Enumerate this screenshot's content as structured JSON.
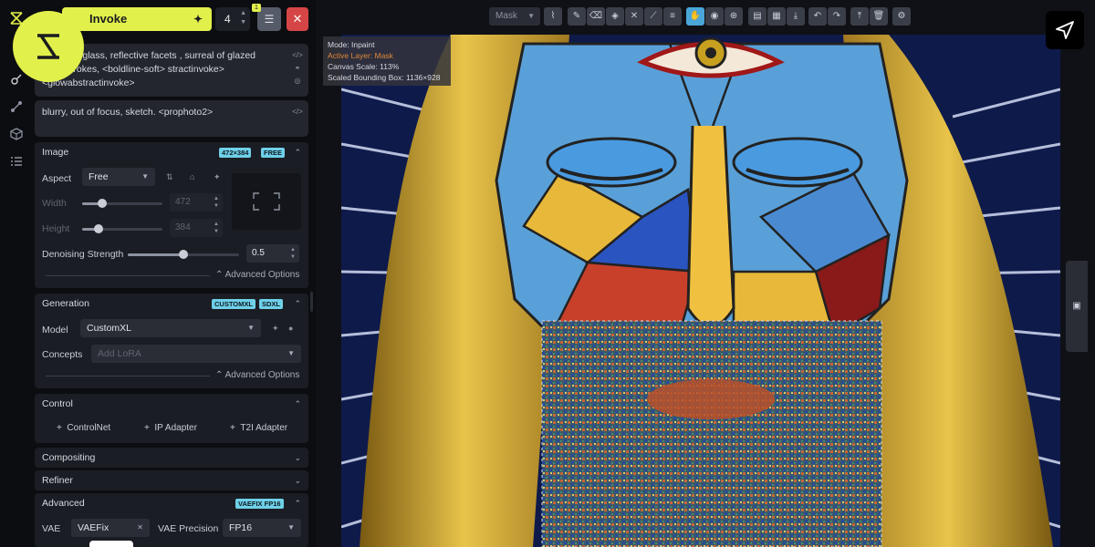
{
  "rail": {
    "icons": [
      "invoke-logo-icon",
      "brush-icon",
      "workflow-icon",
      "models-icon",
      "queue-list-icon"
    ]
  },
  "logo_badge": {
    "icon": "invoke-logo-icon",
    "color": "#e2f04b"
  },
  "topbar": {
    "invoke_label": "Invoke",
    "iterations": "4",
    "queue_count": "1"
  },
  "positive_prompt": {
    "text": "fractured glass, reflective facets , surreal of glazed brushstrokes, <boldline-soft> stractinvoke> <glowabstractinvoke>"
  },
  "negative_prompt": {
    "text": "blurry, out of focus, sketch. <prophoto2>"
  },
  "image": {
    "title": "Image",
    "size_badge": "472×384",
    "free_badge": "FREE",
    "aspect_label": "Aspect",
    "aspect_value": "Free",
    "width_label": "Width",
    "width_value": "472",
    "width_fraction": 0.25,
    "height_label": "Height",
    "height_value": "384",
    "height_fraction": 0.2,
    "denoise_label": "Denoising Strength",
    "denoise_value": "0.5",
    "advanced_label": "Advanced Options"
  },
  "generation": {
    "title": "Generation",
    "badge1": "CUSTOMXL",
    "badge2": "SDXL",
    "model_label": "Model",
    "model_value": "CustomXL",
    "concepts_label": "Concepts",
    "concepts_placeholder": "Add LoRA",
    "advanced_label": "Advanced Options"
  },
  "control": {
    "title": "Control",
    "controlnet": "ControlNet",
    "ip_adapter": "IP Adapter",
    "t2i_adapter": "T2I Adapter"
  },
  "compositing": {
    "title": "Compositing"
  },
  "refiner": {
    "title": "Refiner"
  },
  "advanced": {
    "title": "Advanced",
    "badge": "VAEFIX FP16",
    "vae_label": "VAE",
    "vae_value": "VAEFix",
    "precision_label": "VAE Precision",
    "precision_value": "FP16"
  },
  "canvas": {
    "tool_select": "Mask",
    "mode_line": "Mode: Inpaint",
    "layer_line": "Active Layer: Mask",
    "scale_line": "Canvas Scale: 113%",
    "bbox_line": "Scaled Bounding Box: 1136×928",
    "colors": {
      "accent": "#e2f04b",
      "active_tool": "#4aa6d8",
      "warning": "#e0883a",
      "danger": "#d64545"
    }
  }
}
